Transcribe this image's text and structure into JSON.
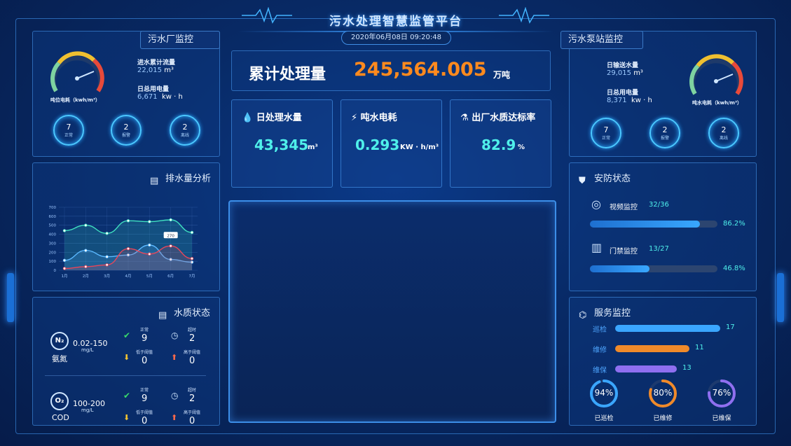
{
  "header": {
    "title": "污水处理智慧监管平台",
    "datetime": "2020年06月08日  09:20:48"
  },
  "plant": {
    "tab": "污水厂监控",
    "gauge_label": "吨位电耗（kwh/m³）",
    "flow_label": "进水累计流量",
    "flow_value": "22,015",
    "flow_unit": "m³",
    "power_label": "日总用电量",
    "power_value": "6,671",
    "power_unit": "kw · h",
    "rings": [
      {
        "n": "7",
        "t": "正常"
      },
      {
        "n": "2",
        "t": "报警"
      },
      {
        "n": "2",
        "t": "离线"
      }
    ]
  },
  "total": {
    "label": "累计处理量",
    "value": "245,564.005",
    "unit": "万吨"
  },
  "kpis": [
    {
      "label": "日处理水量",
      "value": "43,345",
      "unit": "m³"
    },
    {
      "label": "吨水电耗",
      "value": "0.293",
      "unit": "KW · h/m³"
    },
    {
      "label": "出厂水质达标率",
      "value": "82.9",
      "unit": "%"
    }
  ],
  "pump": {
    "tab": "污水泵站监控",
    "send_label": "日输送水量",
    "send_value": "29,015",
    "send_unit": "m³",
    "power_label": "日总用电量",
    "power_value": "8,371",
    "power_unit": "kw · h",
    "gauge_label": "吨水电耗（kwh/m³）",
    "rings": [
      {
        "n": "7",
        "t": "正常"
      },
      {
        "n": "2",
        "t": "报警"
      },
      {
        "n": "2",
        "t": "离线"
      }
    ]
  },
  "drain": {
    "title": "排水量分析",
    "tooltip": "270"
  },
  "chart_data": {
    "type": "line",
    "categories": [
      "1月",
      "2月",
      "3月",
      "4月",
      "5月",
      "6月",
      "7月"
    ],
    "yticks": [
      "0",
      "100",
      "200",
      "300",
      "400",
      "500",
      "600",
      "700"
    ],
    "ylim": [
      0,
      700
    ],
    "series": [
      {
        "color": "#3fe0c0",
        "values": [
          440,
          500,
          410,
          550,
          540,
          560,
          420
        ]
      },
      {
        "color": "#5ab8ff",
        "values": [
          110,
          220,
          150,
          170,
          280,
          120,
          90
        ]
      },
      {
        "color": "#e8465a",
        "values": [
          20,
          40,
          60,
          240,
          180,
          270,
          130
        ]
      }
    ]
  },
  "water": {
    "title": "水质状态",
    "rows": [
      {
        "chem": "N₂",
        "range": "0.02-150",
        "unit": "mg/L",
        "name": "氨氮",
        "normal": "9",
        "overtime": "2",
        "low": "0",
        "high": "0"
      },
      {
        "chem": "O₂",
        "range": "100-200",
        "unit": "mg/L",
        "name": "COD",
        "normal": "9",
        "overtime": "2",
        "low": "0",
        "high": "0"
      }
    ],
    "labels": {
      "normal": "正常",
      "overtime": "超时",
      "low": "低于阈值",
      "high": "高于阈值"
    }
  },
  "security": {
    "title": "安防状态",
    "items": [
      {
        "label": "视频监控",
        "count": "32/36",
        "pct": "86.2%",
        "fill": 0.862,
        "color": "#39a8ff"
      },
      {
        "label": "门禁监控",
        "count": "13/27",
        "pct": "46.8%",
        "fill": 0.468,
        "color": "#39a8ff"
      }
    ]
  },
  "service": {
    "title": "服务监控",
    "bars": [
      {
        "label": "巡检",
        "value": "17",
        "fill": 0.85,
        "color": "#3aa6ff"
      },
      {
        "label": "维修",
        "value": "11",
        "fill": 0.6,
        "color": "#f08a2a"
      },
      {
        "label": "维保",
        "value": "13",
        "fill": 0.5,
        "color": "#8f6ff0"
      }
    ],
    "donuts": [
      {
        "pct": "94%",
        "label": "已巡检",
        "fill": 0.94,
        "color": "#3aa6ff"
      },
      {
        "pct": "80%",
        "label": "已维修",
        "fill": 0.8,
        "color": "#f08a2a"
      },
      {
        "pct": "76%",
        "label": "已维保",
        "fill": 0.76,
        "color": "#8f6ff0"
      }
    ]
  }
}
